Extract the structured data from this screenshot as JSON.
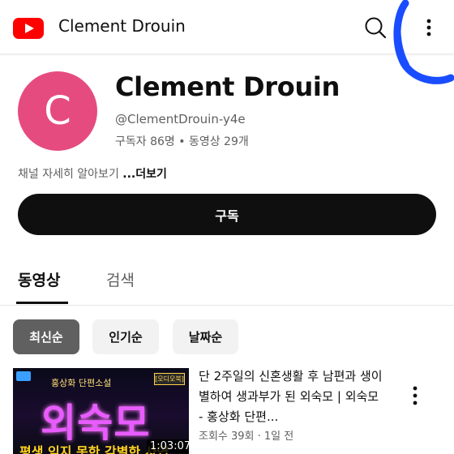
{
  "header": {
    "title": "Clement Drouin",
    "logo_icon": "youtube-logo-icon",
    "search_icon": "search-icon",
    "menu_icon": "more-vert-icon"
  },
  "channel": {
    "avatar_letter": "C",
    "avatar_color": "#e64b7f",
    "name": "Clement Drouin",
    "handle": "@ClementDrouin-y4e",
    "stats": "구독자 86명 • 동영상 29개",
    "about_text": "채널 자세히 알아보기 ",
    "more_label": "...더보기",
    "subscribe_label": "구독"
  },
  "tabs": [
    {
      "label": "동영상",
      "selected": true
    },
    {
      "label": "검색",
      "selected": false
    }
  ],
  "filters": [
    {
      "label": "최신순",
      "selected": true
    },
    {
      "label": "인기순",
      "selected": false
    },
    {
      "label": "날짜순",
      "selected": false
    }
  ],
  "videos": [
    {
      "title": "단 2주일의 신혼생활 후 남편과 생이별하여 생과부가 된 외숙모 | 외숙모 - 홍상화 단편...",
      "meta": "조회수 39회 · 1일 전",
      "duration": "1:03:07",
      "thumb_top": "홍상화 단편소설",
      "thumb_big": "외숙모",
      "thumb_bottom": "평생 잊지 못한 각별한 사연",
      "thumb_badge": "[오디오북]"
    }
  ],
  "colors": {
    "brand_red": "#ff0000",
    "annotation_blue": "#1a4dff"
  }
}
